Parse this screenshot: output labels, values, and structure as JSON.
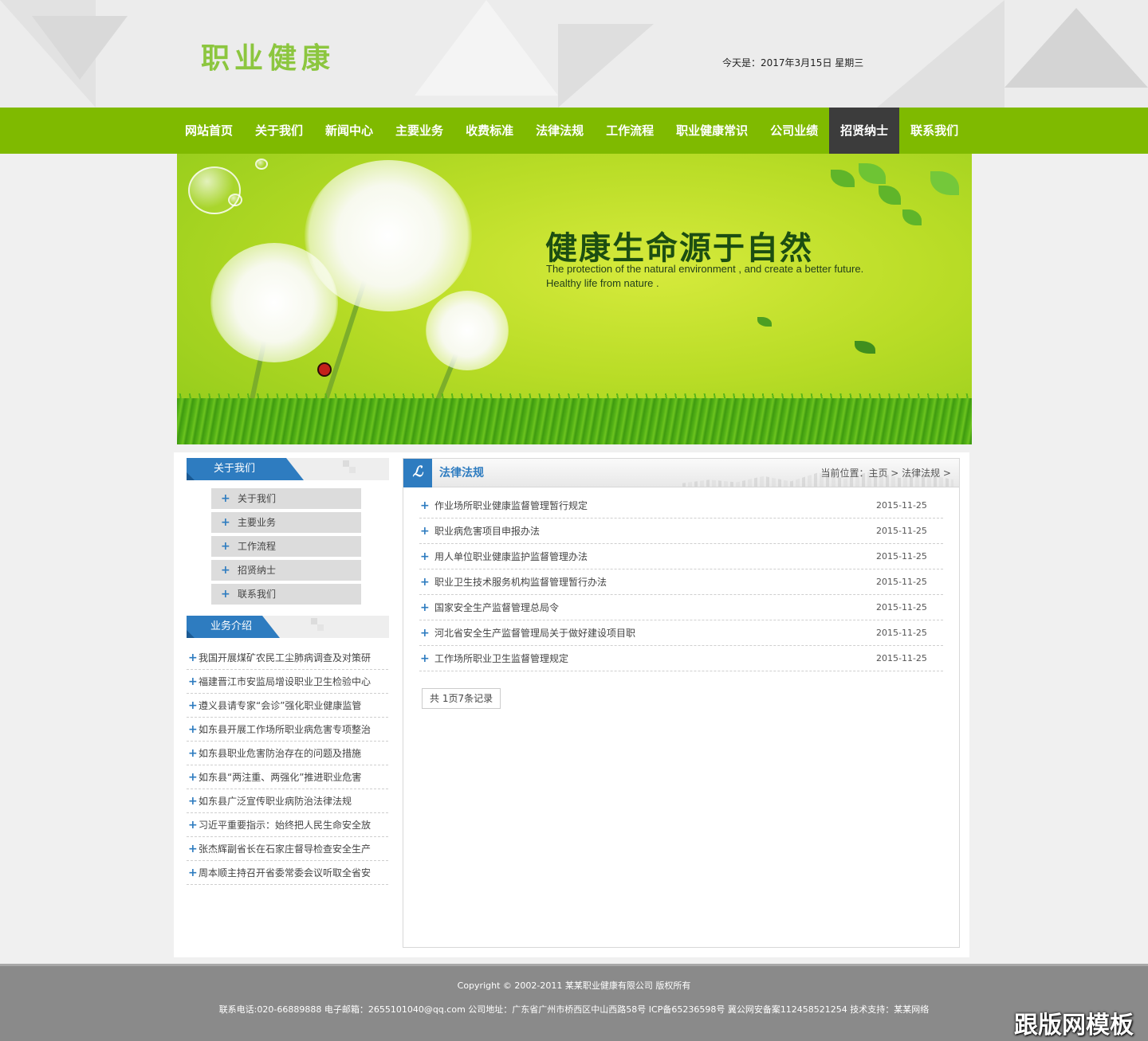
{
  "header": {
    "logo": "职业健康",
    "date": "今天是：2017年3月15日 星期三"
  },
  "nav": {
    "items": [
      "网站首页",
      "关于我们",
      "新闻中心",
      "主要业务",
      "收费标准",
      "法律法规",
      "工作流程",
      "职业健康常识",
      "公司业绩",
      "招贤纳士",
      "联系我们"
    ],
    "active": "招贤纳士"
  },
  "banner": {
    "title": "健康生命源于自然",
    "sub1": "The protection of the natural environment , and create a better future.",
    "sub2": "Healthy life from nature ."
  },
  "sidebar": {
    "about_title": "关于我们",
    "about_items": [
      "关于我们",
      "主要业务",
      "工作流程",
      "招贤纳士",
      "联系我们"
    ],
    "biz_title": "业务介绍",
    "biz_items": [
      "我国开展煤矿农民工尘肺病调查及对策研",
      "福建晋江市安监局增设职业卫生检验中心",
      "遵义县请专家“会诊”强化职业健康监管",
      "如东县开展工作场所职业病危害专项整治",
      "如东县职业危害防治存在的问题及措施",
      "如东县“两注重、两强化”推进职业危害",
      "如东县广泛宣传职业病防治法律法规",
      "习近平重要指示：始终把人民生命安全放",
      "张杰辉副省长在石家庄督导检查安全生产",
      "周本顺主持召开省委常委会议听取全省安"
    ]
  },
  "content": {
    "title": "法律法规",
    "crumb": "当前位置：主页 > 法律法规 >",
    "items": [
      {
        "title": "作业场所职业健康监督管理暂行规定",
        "date": "2015-11-25"
      },
      {
        "title": "职业病危害项目申报办法",
        "date": "2015-11-25"
      },
      {
        "title": "用人单位职业健康监护监督管理办法",
        "date": "2015-11-25"
      },
      {
        "title": "职业卫生技术服务机构监督管理暂行办法",
        "date": "2015-11-25"
      },
      {
        "title": "国家安全生产监督管理总局令",
        "date": "2015-11-25"
      },
      {
        "title": "河北省安全生产监督管理局关于做好建设项目职",
        "date": "2015-11-25"
      },
      {
        "title": "工作场所职业卫生监督管理规定",
        "date": "2015-11-25"
      }
    ],
    "pager": "共 1页7条记录"
  },
  "footer": {
    "copyright": "Copyright © 2002-2011 某某职业健康有限公司 版权所有",
    "contact": "联系电话:020-66889888 电子邮箱：2655101040@qq.com 公司地址：广东省广州市桥西区中山西路58号 ICP备65236598号 冀公网安备案112458521254 技术支持：某某网络"
  },
  "watermark": "跟版网模板",
  "colors": {
    "brand_green": "#7fba00",
    "accent_blue": "#2e7cc0",
    "nav_active": "#3c3c3c"
  }
}
